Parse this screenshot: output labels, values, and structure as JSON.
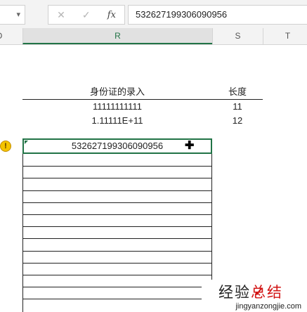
{
  "toolbar": {
    "namebox_arrow": "▾",
    "cancel_glyph": "✕",
    "enter_glyph": "✓",
    "fx_label": "fx",
    "formula_value": "532627199306090956"
  },
  "columns": [
    {
      "label": "O"
    },
    {
      "label": "R",
      "selected": true
    },
    {
      "label": "S"
    },
    {
      "label": "T"
    }
  ],
  "table": {
    "header_id": "身份证的录入",
    "header_len": "长度",
    "rows": [
      {
        "id": "11111111111",
        "len": "11"
      },
      {
        "id": "1.11111E+11",
        "len": "12"
      }
    ]
  },
  "active_cell": {
    "value": "532627199306090956",
    "cursor_glyph": "✚"
  },
  "warning_glyph": "!",
  "watermark": {
    "cn_part1": "经验",
    "cn_part2": "总结",
    "en": "jingyanzongjie.com"
  },
  "colors": {
    "accent_green": "#217346",
    "warning_yellow": "#f5c400",
    "watermark_red": "#d21414"
  }
}
